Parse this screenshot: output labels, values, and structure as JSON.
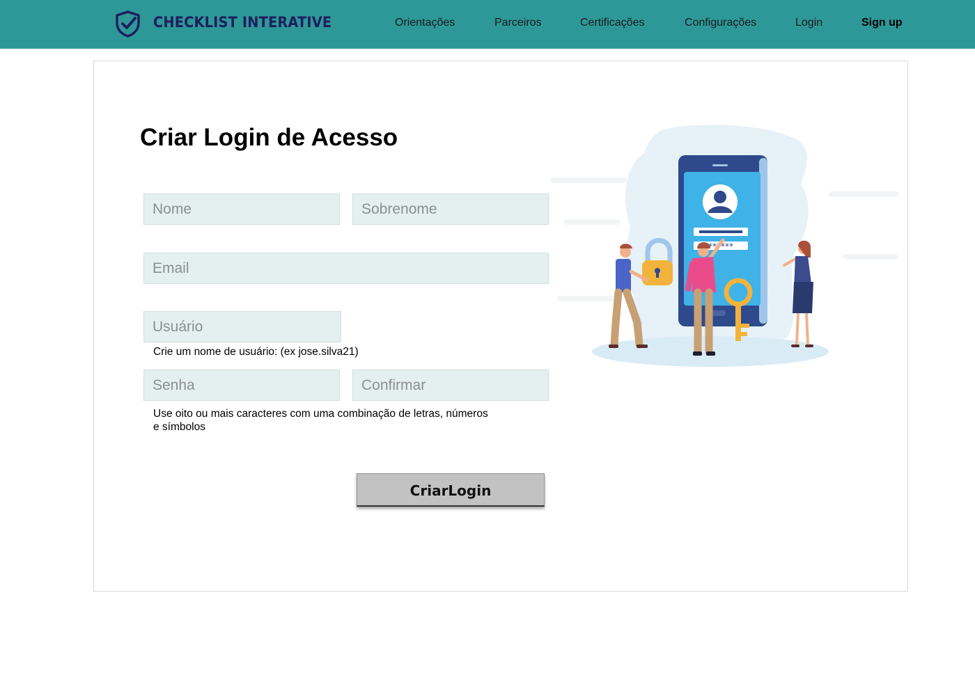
{
  "header": {
    "brand": "CHECKLIST INTERATIVE",
    "nav": [
      {
        "label": "Orientações"
      },
      {
        "label": "Parceiros"
      },
      {
        "label": "Certificações"
      },
      {
        "label": "Configurações"
      },
      {
        "label": "Login"
      },
      {
        "label": "Sign up"
      }
    ]
  },
  "form": {
    "title": "Criar Login de Acesso",
    "nome_placeholder": "Nome",
    "sobrenome_placeholder": "Sobrenome",
    "email_placeholder": "Email",
    "usuario_placeholder": "Usuário",
    "usuario_hint": "Crie um nome de usuário: (ex jose.silva21)",
    "senha_placeholder": "Senha",
    "confirmar_placeholder": "Confirmar",
    "senha_hint_line1": "Use oito ou mais caracteres com uma combinação de letras, números",
    "senha_hint_line2": "e símbolos",
    "submit_label": "CriarLogin"
  },
  "illustration": {
    "password_mask": "******"
  },
  "colors": {
    "header_bg": "#2e9898",
    "brand": "#1c1f5e",
    "field_bg": "#e4f0f0",
    "button_bg": "#c2c2c2"
  }
}
